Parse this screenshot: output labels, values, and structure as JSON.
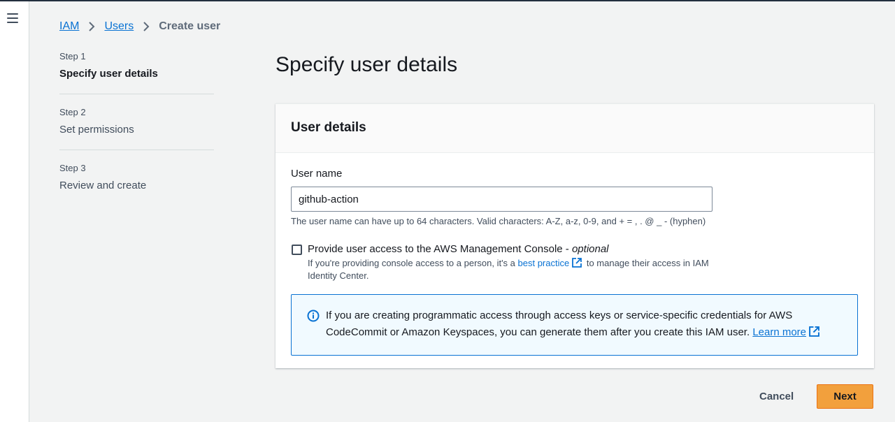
{
  "nav": {
    "menu_icon": "hamburger-menu-icon"
  },
  "breadcrumb": [
    {
      "label": "IAM",
      "link": true
    },
    {
      "label": "Users",
      "link": true
    },
    {
      "label": "Create user",
      "link": false
    }
  ],
  "steps": [
    {
      "number": "Step 1",
      "title": "Specify user details",
      "active": true
    },
    {
      "number": "Step 2",
      "title": "Set permissions",
      "active": false
    },
    {
      "number": "Step 3",
      "title": "Review and create",
      "active": false
    }
  ],
  "page_title": "Specify user details",
  "user_details": {
    "header": "User details",
    "user_name_label": "User name",
    "user_name_value": "github-action",
    "user_name_constraint": "The user name can have up to 64 characters. Valid characters: A-Z, a-z, 0-9, and + = , . @ _ - (hyphen)",
    "console_access": {
      "label": "Provide user access to the AWS Management Console - ",
      "optional": "optional",
      "checked": false,
      "desc_before": "If you're providing console access to a person, it's a ",
      "desc_link": "best practice",
      "desc_after": " to manage their access in IAM Identity Center."
    },
    "info_alert": {
      "icon": "info-icon",
      "text": "If you are creating programmatic access through access keys or service-specific credentials for AWS CodeCommit or Amazon Keyspaces, you can generate them after you create this IAM user. ",
      "link": "Learn more"
    }
  },
  "footer": {
    "cancel_label": "Cancel",
    "next_label": "Next"
  },
  "colors": {
    "link": "#0972d3",
    "primary_button": "#f2a03d",
    "info_border": "#0972d3"
  }
}
